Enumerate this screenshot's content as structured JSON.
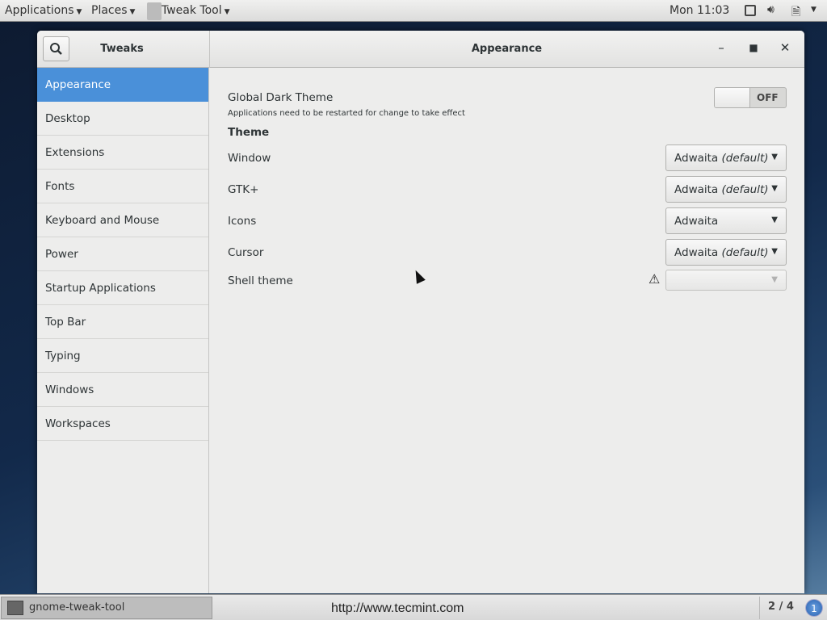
{
  "topbar": {
    "applications": "Applications",
    "places": "Places",
    "app_menu": "Tweak Tool",
    "clock": "Mon 11:03"
  },
  "window": {
    "sidebar_title": "Tweaks",
    "title": "Appearance"
  },
  "sidebar": {
    "items": [
      {
        "label": "Appearance"
      },
      {
        "label": "Desktop"
      },
      {
        "label": "Extensions"
      },
      {
        "label": "Fonts"
      },
      {
        "label": "Keyboard and Mouse"
      },
      {
        "label": "Power"
      },
      {
        "label": "Startup Applications"
      },
      {
        "label": "Top Bar"
      },
      {
        "label": "Typing"
      },
      {
        "label": "Windows"
      },
      {
        "label": "Workspaces"
      }
    ]
  },
  "main": {
    "dark_theme_label": "Global Dark Theme",
    "dark_theme_note": "Applications need to be restarted for change to take effect",
    "dark_theme_state": "OFF",
    "theme_heading": "Theme",
    "rows": [
      {
        "label": "Window",
        "value": "Adwaita",
        "suffix": "(default)"
      },
      {
        "label": "GTK+",
        "value": "Adwaita",
        "suffix": "(default)"
      },
      {
        "label": "Icons",
        "value": "Adwaita",
        "suffix": ""
      },
      {
        "label": "Cursor",
        "value": "Adwaita",
        "suffix": "(default)"
      }
    ],
    "shell_label": "Shell theme"
  },
  "taskbar": {
    "task": "gnome-tweak-tool",
    "url": "http://www.tecmint.com",
    "workspace": "2 / 4",
    "notifications": "1"
  }
}
